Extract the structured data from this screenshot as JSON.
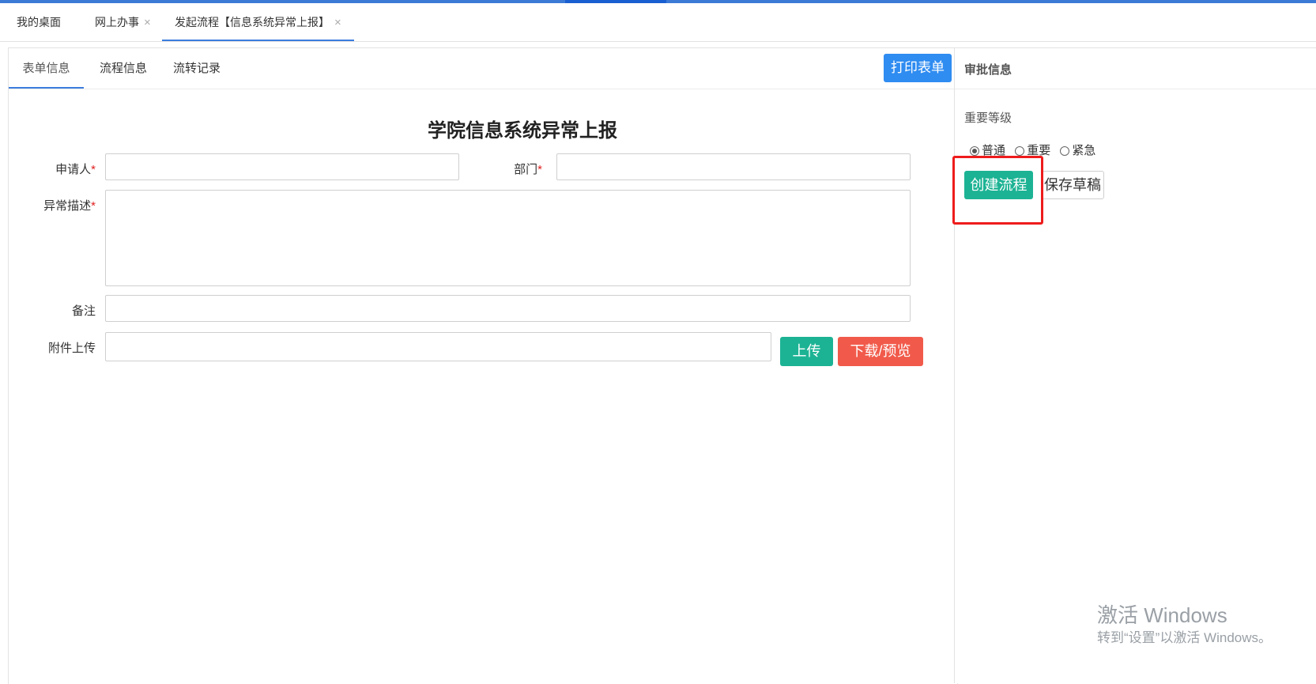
{
  "tabs": [
    {
      "label": "我的桌面",
      "closable": false
    },
    {
      "label": "网上办事",
      "closable": true
    },
    {
      "label": "发起流程【信息系统异常上报】",
      "closable": true,
      "active": true
    }
  ],
  "close_icon": "×",
  "subtabs": [
    {
      "label": "表单信息",
      "active": true
    },
    {
      "label": "流程信息"
    },
    {
      "label": "流转记录"
    }
  ],
  "print_button": "打印表单",
  "form": {
    "title": "学院信息系统异常上报",
    "required_mark": "*",
    "applicant_label": "申请人",
    "applicant_value": "",
    "department_label": "部门",
    "department_value": "",
    "description_label": "异常描述",
    "description_value": "",
    "remark_label": "备注",
    "remark_value": "",
    "attachment_label": "附件上传",
    "attachment_value": "",
    "upload_button": "上传",
    "download_button": "下载/预览"
  },
  "approval": {
    "title": "审批信息",
    "priority_label": "重要等级",
    "options": [
      "普通",
      "重要",
      "紧急"
    ],
    "selected": "普通",
    "create_button": "创建流程",
    "draft_button": "保存草稿"
  },
  "watermark": {
    "title": "激活 Windows",
    "subtitle": "转到“设置”以激活 Windows。"
  },
  "colors": {
    "accent": "#2f8cf1",
    "green": "#1cb394",
    "red": "#f15a4a",
    "highlight": "#ee1c1c"
  }
}
